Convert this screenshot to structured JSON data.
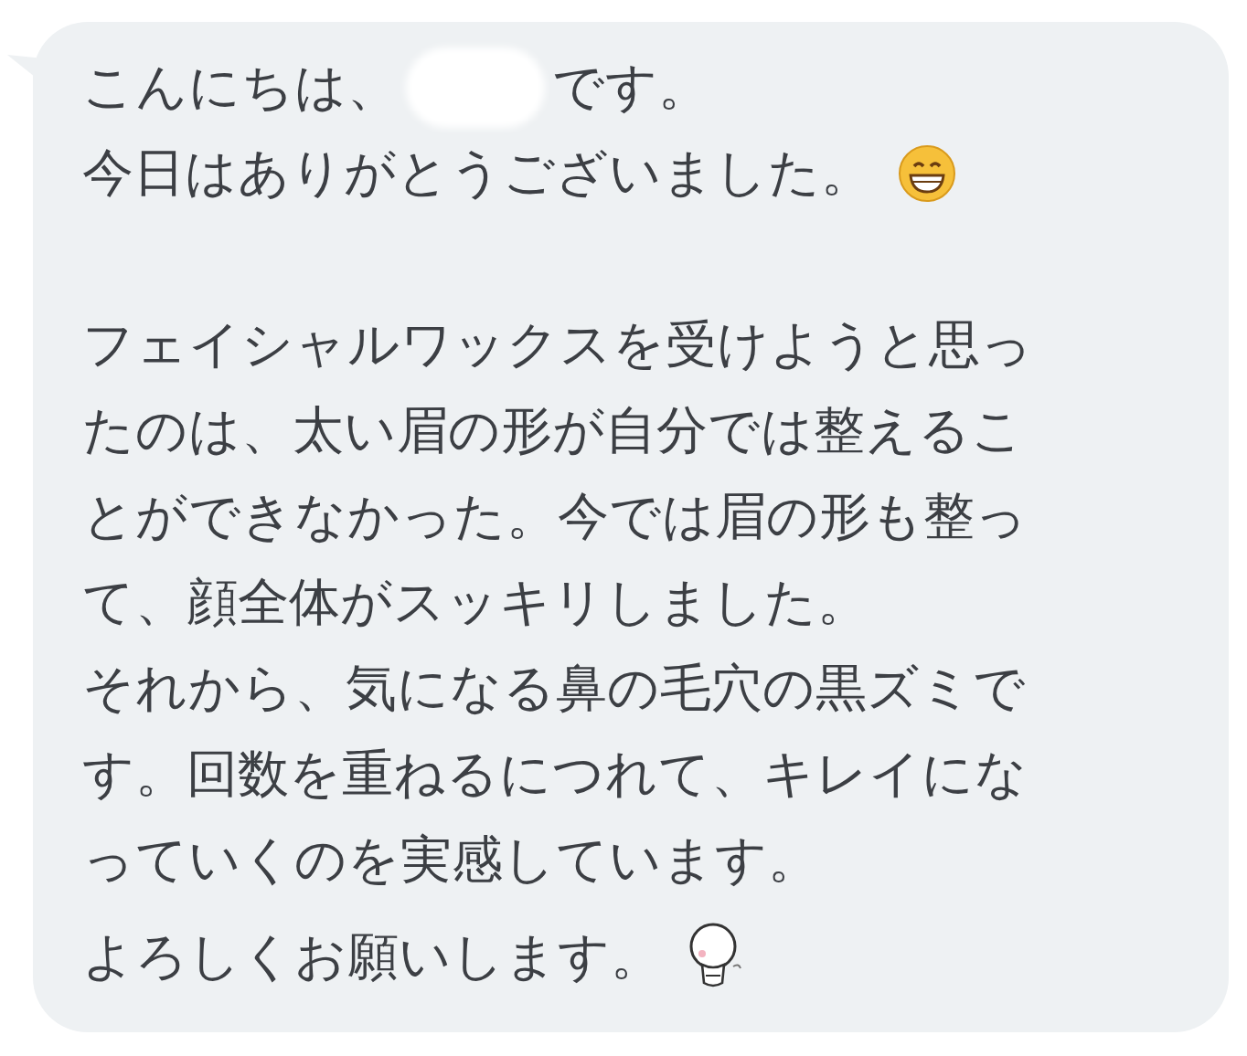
{
  "message": {
    "greeting": {
      "before": "こんにちは、",
      "redacted": true,
      "after": "です。"
    },
    "blocks": [
      {
        "paragraphs": [
          {
            "kind": "grin",
            "lines": [
              "今日はありがとうございました。"
            ]
          }
        ]
      },
      {
        "paragraphs": [
          {
            "kind": "plain",
            "lines": [
              "フェイシャルワックスを受けようと思っ",
              "たのは、太い眉の形が自分では整えるこ",
              "とができなかった。今では眉の形も整っ",
              "て、顔全体がスッキリしました。"
            ]
          },
          {
            "kind": "plain",
            "lines": [
              "それから、気になる鼻の毛穴の黒ズミで",
              "す。回数を重ねるにつれて、キレイにな",
              "っていくのを実感しています。"
            ]
          }
        ]
      },
      {
        "paragraphs": [
          {
            "kind": "sticker",
            "lines": [
              "よろしくお願いします。"
            ]
          }
        ]
      }
    ]
  }
}
